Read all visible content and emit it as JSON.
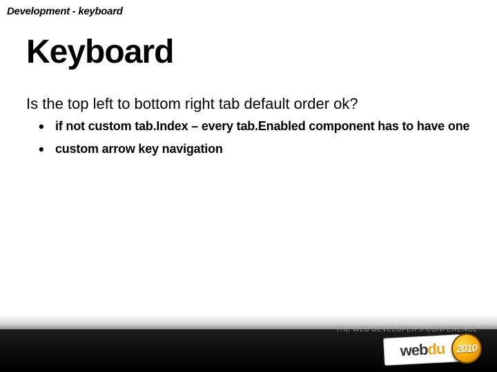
{
  "breadcrumb": "Development - keyboard",
  "title": "Keyboard",
  "question": "Is the top left to bottom right tab default order ok?",
  "bullets": [
    "if not custom tab.Index – every tab.Enabled component has to have one",
    "custom arrow key navigation"
  ],
  "footer": {
    "tagline": "THE WEB DEVELOPER'S CONFERENCE",
    "logo_text_a": "web",
    "logo_text_b": "du",
    "year": "2010"
  }
}
